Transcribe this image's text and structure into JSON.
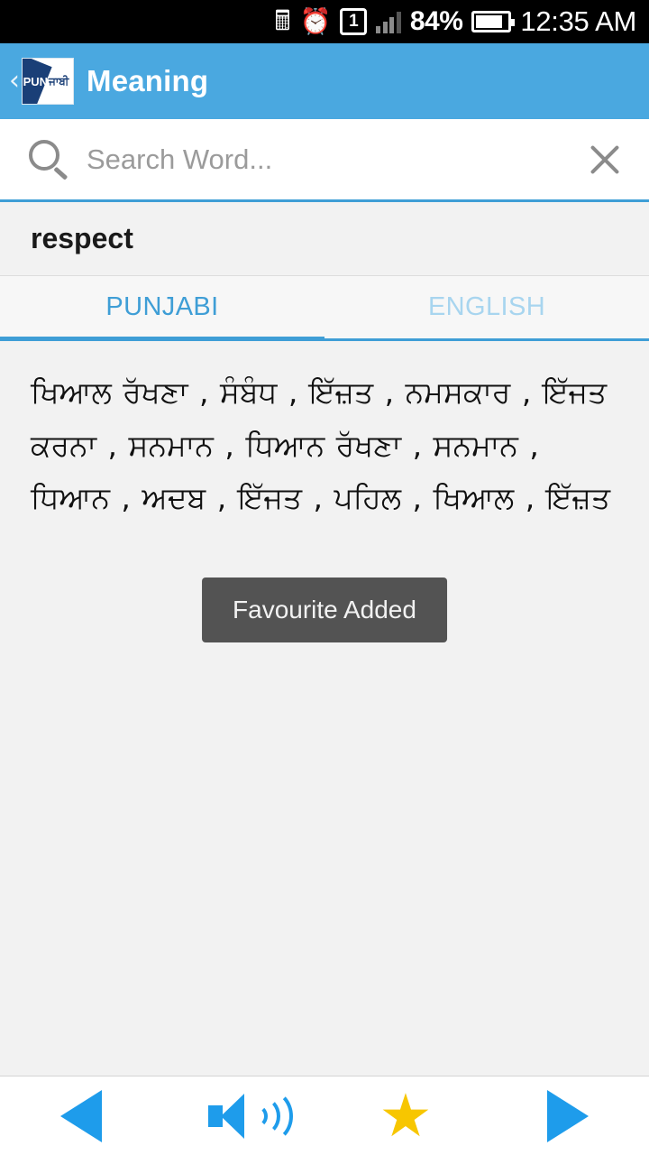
{
  "statusbar": {
    "bluetooth_icon": "bluetooth-icon",
    "alarm_icon": "alarm-icon",
    "sim_icon": "sim-card-1-icon",
    "sim_label": "1",
    "signal_icon": "signal-bars-icon",
    "battery_percent": "84%",
    "battery_icon": "battery-icon",
    "clock": "12:35 AM"
  },
  "appbar": {
    "back_label": "‹",
    "logo_text_1": "PUN",
    "logo_text_2": "ਜਾਬੀ",
    "title": "Meaning"
  },
  "search": {
    "placeholder": "Search Word...",
    "value": "",
    "search_icon": "search-icon",
    "clear_icon": "close-icon"
  },
  "word_header": {
    "word": "respect"
  },
  "tabs": [
    {
      "label": "PUNJABI",
      "active": true
    },
    {
      "label": "ENGLISH",
      "active": false
    }
  ],
  "meaning": {
    "text": "ਖਿਆਲ ਰੱਖਣਾ , ਸੰਬੰਧ , ਇੱਜ਼ਤ , ਨਮਸਕਾਰ , ਇੱਜਤ ਕਰਨਾ , ਸਨਮਾਨ , ਧਿਆਨ ਰੱਖਣਾ , ਸਨਮਾਨ , ਧਿਆਨ , ਅਦਬ , ਇੱਜਤ , ਪਹਿਲ , ਖਿਆਲ , ਇੱਜ਼ਤ"
  },
  "toast": {
    "message": "Favourite Added"
  },
  "bottombar": {
    "previous_icon": "previous-arrow-icon",
    "speak_icon": "speaker-icon",
    "favourite_icon": "star-icon",
    "favourite_glyph": "★",
    "next_icon": "next-arrow-icon"
  },
  "colors": {
    "accent": "#3f9ed6",
    "appbar": "#4aa8e0",
    "bottom_icon": "#1e9ceb",
    "star": "#f7c600",
    "toast_bg": "#535353"
  }
}
